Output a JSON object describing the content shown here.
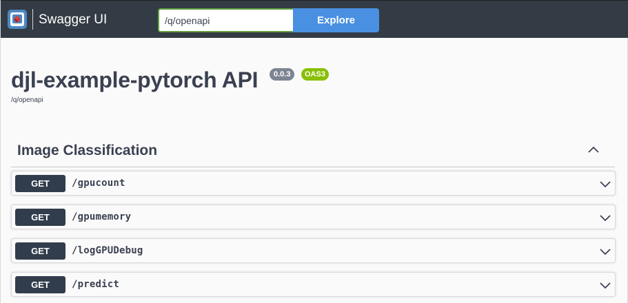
{
  "topbar": {
    "brand": "Swagger UI",
    "url_value": "/q/openapi",
    "explore_label": "Explore"
  },
  "info": {
    "title": "djl-example-pytorch API",
    "version": "0.0.3",
    "oas_badge": "OAS3",
    "spec_url": "/q/openapi"
  },
  "tag": {
    "name": "Image Classification",
    "expanded": true
  },
  "operations": [
    {
      "method": "GET",
      "path": "/gpucount"
    },
    {
      "method": "GET",
      "path": "/gpumemory"
    },
    {
      "method": "GET",
      "path": "/logGPUDebug"
    },
    {
      "method": "GET",
      "path": "/predict"
    }
  ],
  "colors": {
    "topbar_bg": "#333b44",
    "explore_bg": "#4990e2",
    "method_get_bg": "#313d4c",
    "version_badge_bg": "#7d8492",
    "oas_badge_bg": "#89bf04"
  },
  "icons": {
    "logo": "swagger-logo-icon",
    "tag_toggle": "chevron-up-icon",
    "op_toggle": "chevron-down-icon"
  }
}
